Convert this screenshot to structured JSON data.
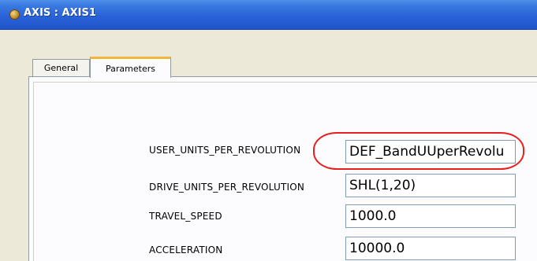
{
  "window": {
    "title": "AXIS : AXIS1"
  },
  "tabs": [
    {
      "label": "General",
      "active": false
    },
    {
      "label": "Parameters",
      "active": true
    }
  ],
  "parameters": [
    {
      "label": "USER_UNITS_PER_REVOLUTION",
      "value": "DEF_BandUUperRevolu"
    },
    {
      "label": "DRIVE_UNITS_PER_REVOLUTION",
      "value": "SHL(1,20)"
    },
    {
      "label": "TRAVEL_SPEED",
      "value": "1000.0"
    },
    {
      "label": "ACCELERATION",
      "value": "10000.0"
    }
  ],
  "colors": {
    "title_bar": "#2a63d8",
    "active_tab_accent": "#f1b53a",
    "annotation_circle": "#e6201f"
  }
}
